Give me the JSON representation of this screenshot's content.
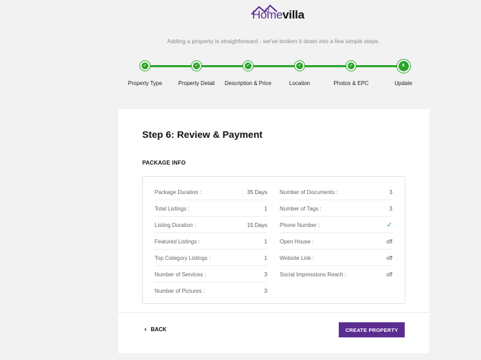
{
  "brand": {
    "part1": "Home",
    "part2": "villa",
    "accent": "#5c2d91"
  },
  "subtitle": "Adding a property is straighforward - we've broken it down into a few simple steps.",
  "steps": [
    {
      "label": "Property Type",
      "state": "complete",
      "icon": "check-icon"
    },
    {
      "label": "Property Detail",
      "state": "complete",
      "icon": "check-icon"
    },
    {
      "label": "Description & Price",
      "state": "complete",
      "icon": "check-icon"
    },
    {
      "label": "Location",
      "state": "complete",
      "icon": "check-icon"
    },
    {
      "label": "Photos & EPC",
      "state": "complete",
      "icon": "check-icon"
    },
    {
      "label": "Update",
      "state": "current",
      "number": "6"
    }
  ],
  "step_color": "#2aa52a",
  "card": {
    "title": "Step 6: Review & Payment",
    "section_title": "PACKAGE INFO",
    "left": [
      {
        "label": "Package Duration :",
        "value": "35 Days"
      },
      {
        "label": "Total Listings :",
        "value": "1"
      },
      {
        "label": "Listing Duration :",
        "value": "15 Days"
      },
      {
        "label": "Featured Listings :",
        "value": "1"
      },
      {
        "label": "Top Category Listings :",
        "value": "1"
      },
      {
        "label": "Number of Services :",
        "value": "3"
      },
      {
        "label": "Number of Pictures :",
        "value": "3"
      }
    ],
    "right": [
      {
        "label": "Number of Documents :",
        "value": "3"
      },
      {
        "label": "Number of Tags :",
        "value": "3"
      },
      {
        "label": "Phone Number :",
        "value": "✓"
      },
      {
        "label": "Open House :",
        "value": "off"
      },
      {
        "label": "Website Link :",
        "value": "off"
      },
      {
        "label": "Social Impressions Reach :",
        "value": "off"
      }
    ],
    "back_label": "BACK",
    "create_label": "CREATE PROPERTY"
  }
}
